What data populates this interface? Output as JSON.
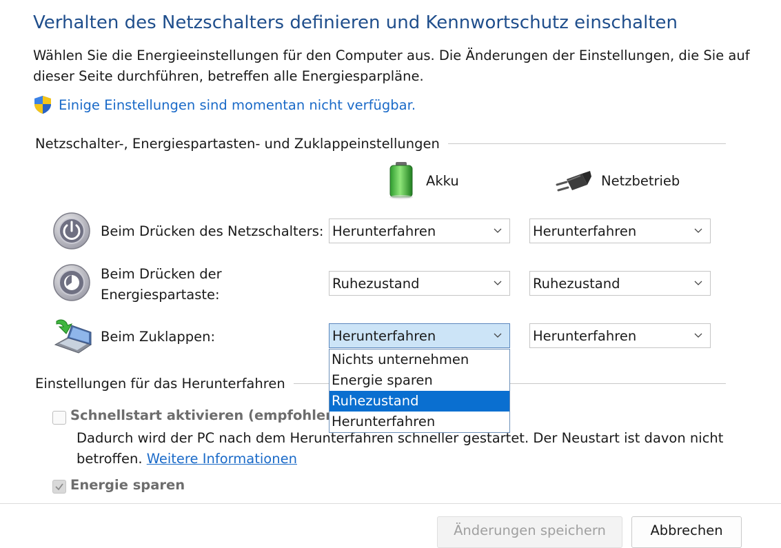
{
  "header": {
    "title": "Verhalten des Netzschalters definieren und Kennwortschutz einschalten",
    "description": "Wählen Sie die Energieeinstellungen für den Computer aus. Die Änderungen der Einstellungen, die Sie auf dieser Seite durchführen, betreffen alle Energiesparpläne.",
    "warning_link": "Einige Einstellungen sind momentan nicht verfügbar."
  },
  "buttons_section": {
    "title": "Netzschalter-, Energiespartasten- und Zuklappeinstellungen",
    "columns": [
      {
        "label": "Akku",
        "icon": "battery-icon"
      },
      {
        "label": "Netzbetrieb",
        "icon": "power-plug-icon"
      }
    ],
    "rows": [
      {
        "label": "Beim Drücken des Netzschalters:",
        "icon": "power-button-icon",
        "battery": "Herunterfahren",
        "plugged": "Herunterfahren"
      },
      {
        "label_line1": "Beim Drücken der",
        "label_line2": "Energiespartaste:",
        "icon": "sleep-button-icon",
        "battery": "Ruhezustand",
        "plugged": "Ruhezustand"
      },
      {
        "label": "Beim Zuklappen:",
        "icon": "laptop-lid-icon",
        "battery": "Herunterfahren",
        "plugged": "Herunterfahren"
      }
    ]
  },
  "dropdown": {
    "options": [
      "Nichts unternehmen",
      "Energie sparen",
      "Ruhezustand",
      "Herunterfahren"
    ],
    "highlighted": "Ruhezustand"
  },
  "shutdown_section": {
    "title": "Einstellungen für das Herunterfahren",
    "fast_startup": {
      "label": "Schnellstart aktivieren (empfohlen)",
      "checked": false,
      "description_line1": "Dadurch wird der PC nach dem Herunterfahren schneller gestartet. Der Neustart ist davon nicht",
      "description_prefix": "betroffen.",
      "more_info_link": "Weitere Informationen"
    },
    "sleep": {
      "label": "Energie sparen",
      "checked": true
    }
  },
  "footer": {
    "save_label": "Änderungen speichern",
    "cancel_label": "Abbrechen"
  },
  "colors": {
    "title": "#1f4e8c",
    "link": "#1a6ac8",
    "highlight": "#0a6fd0",
    "focused_select": "#cce4f7"
  }
}
